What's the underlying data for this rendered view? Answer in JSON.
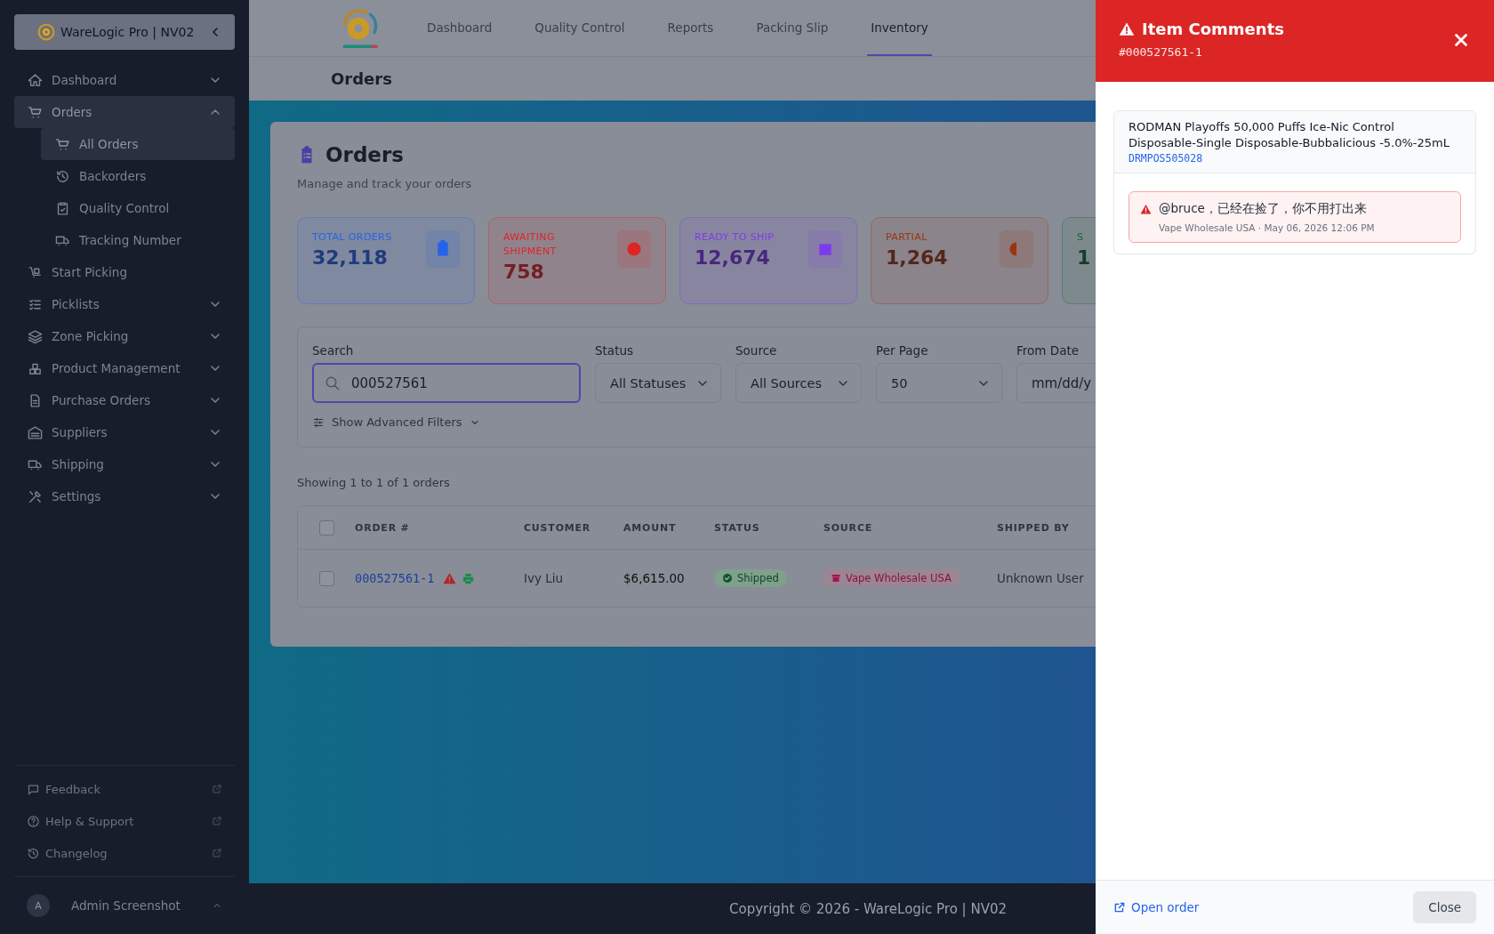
{
  "sidebar": {
    "brand": "WareLogic Pro | NV02",
    "items": [
      {
        "label": "Dashboard",
        "selected": false,
        "expanded": false
      },
      {
        "label": "Orders",
        "selected": true,
        "expanded": true,
        "children": [
          {
            "label": "All Orders",
            "selected": true
          },
          {
            "label": "Backorders",
            "selected": false
          },
          {
            "label": "Quality Control",
            "selected": false
          },
          {
            "label": "Tracking Number",
            "selected": false
          }
        ]
      },
      {
        "label": "Start Picking",
        "selected": false
      },
      {
        "label": "Picklists",
        "selected": false,
        "expanded": false
      },
      {
        "label": "Zone Picking",
        "selected": false,
        "expanded": false
      },
      {
        "label": "Product Management",
        "selected": false,
        "expanded": false
      },
      {
        "label": "Purchase Orders",
        "selected": false,
        "expanded": false
      },
      {
        "label": "Suppliers",
        "selected": false,
        "expanded": false
      },
      {
        "label": "Shipping",
        "selected": false,
        "expanded": false
      },
      {
        "label": "Settings",
        "selected": false,
        "expanded": false
      }
    ],
    "footer_links": [
      {
        "label": "Feedback"
      },
      {
        "label": "Help & Support"
      },
      {
        "label": "Changelog"
      }
    ],
    "user": {
      "initial": "A",
      "name": "Admin Screenshot"
    }
  },
  "top_nav": {
    "tabs": [
      {
        "label": "Dashboard",
        "selected": false
      },
      {
        "label": "Quality Control",
        "selected": false
      },
      {
        "label": "Reports",
        "selected": false
      },
      {
        "label": "Packing Slip",
        "selected": false
      },
      {
        "label": "Inventory",
        "selected": true
      }
    ]
  },
  "page_title": "Orders",
  "orders_card": {
    "title": "Orders",
    "subtitle": "Manage and track your orders",
    "stats": [
      {
        "label": "TOTAL ORDERS",
        "value": "32,118",
        "color": "#2563eb"
      },
      {
        "label": "AWAITING SHIPMENT",
        "value": "758",
        "color": "#dc2626"
      },
      {
        "label": "READY TO SHIP",
        "value": "12,674",
        "color": "#7c3aed"
      },
      {
        "label": "PARTIAL",
        "value": "1,264",
        "color": "#9a3412"
      },
      {
        "label": "S",
        "value": "1",
        "color": "#166534"
      }
    ],
    "filters": {
      "search": {
        "label": "Search",
        "value": "000527561"
      },
      "selects": [
        {
          "label": "Status",
          "value": "All Statuses"
        },
        {
          "label": "Source",
          "value": "All Sources"
        },
        {
          "label": "Per Page",
          "value": "50"
        }
      ],
      "date": {
        "label": "From Date",
        "placeholder": "mm/dd/y"
      },
      "advanced": "Show Advanced Filters"
    },
    "showing": "Showing 1 to 1 of 1 orders",
    "table": {
      "select_all": {
        "checked": false
      },
      "columns": [
        "ORDER #",
        "CUSTOMER",
        "AMOUNT",
        "STATUS",
        "SOURCE",
        "SHIPPED BY"
      ],
      "rows": [
        {
          "selected": false,
          "order": "000527561-1",
          "customer": "Ivy Liu",
          "amount": "$6,615.00",
          "status": "Shipped",
          "source": "Vape Wholesale USA",
          "shipped_by": "Unknown User"
        }
      ]
    }
  },
  "footer": "Copyright © 2026 - WareLogic Pro | NV02",
  "comments_panel": {
    "title": "Item Comments",
    "order_id": "#000527561-1",
    "item": {
      "name": "RODMAN Playoffs 50,000 Puffs Ice-Nic Control Disposable-Single Disposable-Bubbalicious -5.0%-25mL",
      "sku": "DRMPOS505028"
    },
    "comments": [
      {
        "text": "@bruce，已经在捡了，你不用打出来",
        "meta": "Vape Wholesale USA · May 06, 2026 12:06 PM"
      }
    ],
    "open_link": "Open order",
    "close_button": "Close"
  }
}
